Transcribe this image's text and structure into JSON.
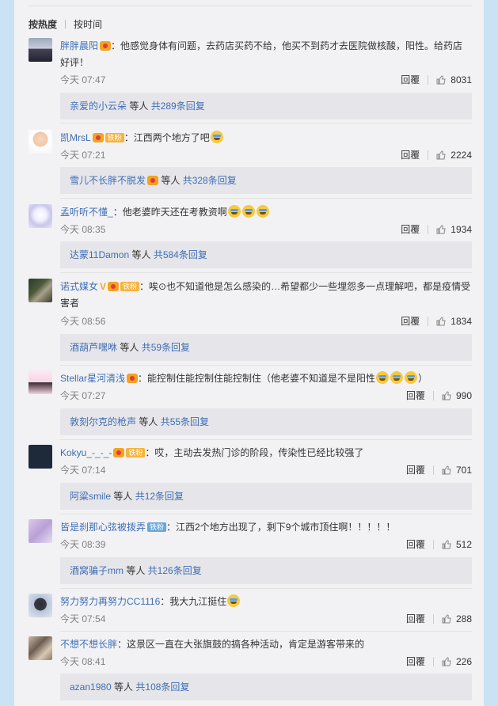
{
  "sort": {
    "hot": "按热度",
    "time": "按时间"
  },
  "action_reply": "回覆",
  "comments": [
    {
      "name": "胖胖晨阳",
      "text": "：他感觉身体有问题，去药店买药不给，他买不到药才去医院做核酸，阳性。给药店好评！",
      "time": "今天 07:47",
      "likes": "8031",
      "reply_user": "亲爱的小云朵",
      "reply_mid": " 等人 ",
      "reply_link": "共289条回复"
    },
    {
      "name": "凯MrsL",
      "text": "：江西两个地方了吧",
      "time": "今天 07:21",
      "likes": "2224",
      "reply_user": "雪儿不长胖不脱发",
      "reply_mid": " 等人 ",
      "reply_link": "共328条回复",
      "fan": "铁粉"
    },
    {
      "name": "孟听听不懂_",
      "text": "：他老婆昨天还在考教资啊",
      "time": "今天 08:35",
      "likes": "1934",
      "reply_user": "达蒙11Damon",
      "reply_mid": " 等人 ",
      "reply_link": "共584条回复"
    },
    {
      "name": "诺式媒女",
      "text": "：唉⊙也不知道他是怎么感染的…希望都少一些埋怨多一点理解吧，都是疫情受害者",
      "time": "今天 08:56",
      "likes": "1834",
      "reply_user": "酒葫芦嘿咻",
      "reply_mid": " 等人 ",
      "reply_link": "共59条回复",
      "fan": "铁粉"
    },
    {
      "name": "Stellar星河清浅",
      "text": "：能控制住能控制住能控制住（他老婆不知道是不是阳性",
      "text2": "）",
      "time": "今天 07:27",
      "likes": "990",
      "reply_user": "敦刻尔克的枪声",
      "reply_mid": " 等人 ",
      "reply_link": "共55条回复"
    },
    {
      "name": "Kokyu_-_-_-",
      "text": "：哎，主动去发热门诊的阶段，传染性已经比较强了",
      "time": "今天 07:14",
      "likes": "701",
      "reply_user": "阿粱smile",
      "reply_mid": " 等人 ",
      "reply_link": "共12条回复",
      "fan": "铁粉"
    },
    {
      "name": "皆是刹那心弦被拨弄",
      "text": "：江西2个地方出现了，剩下9个城市顶住啊！！！！！",
      "time": "今天 08:39",
      "likes": "512",
      "reply_user": "酒窝骗子mm",
      "reply_mid": " 等人 ",
      "reply_link": "共126条回复",
      "fan": "铁粉"
    },
    {
      "name": "努力努力再努力CC1116",
      "text": "：我大九江挺住",
      "time": "今天 07:54",
      "likes": "288"
    },
    {
      "name": "不想不想长胖",
      "text": "：这景区一直在大张旗鼓的搞各种活动，肯定是游客带来的",
      "time": "今天 08:41",
      "likes": "226",
      "reply_user": "azan1980",
      "reply_mid": " 等人 ",
      "reply_link": "共108条回复"
    }
  ],
  "colors": {
    "link": "#3f6db2",
    "meta": "#808080",
    "reply_bg": "#e6e6ea",
    "card_bg": "#f2f2f5",
    "page_bg": "#c9e3f5"
  }
}
